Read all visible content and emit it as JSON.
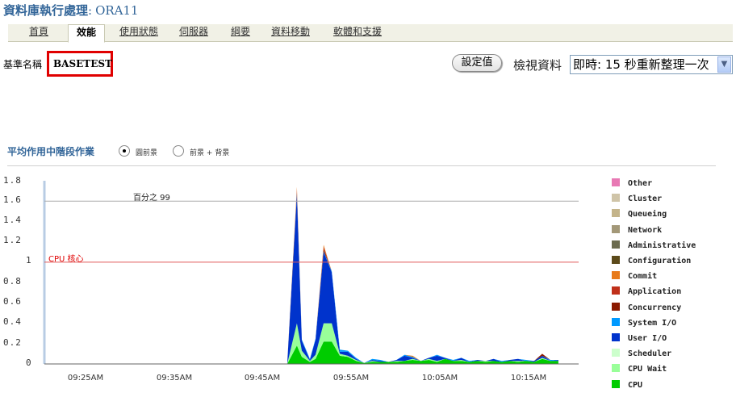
{
  "page": {
    "title_bold": "資料庫執行處理",
    "title_db": "ORA11"
  },
  "tabs": [
    {
      "label": "首頁",
      "active": false
    },
    {
      "label": "效能",
      "active": true
    },
    {
      "label": "使用狀態",
      "active": false
    },
    {
      "label": "伺服器",
      "active": false
    },
    {
      "label": "綱要",
      "active": false
    },
    {
      "label": "資料移動",
      "active": false
    },
    {
      "label": "軟體和支援",
      "active": false
    }
  ],
  "baseline": {
    "label": "基準名稱",
    "value": "BASETEST"
  },
  "toolbar": {
    "set_button": "設定值",
    "view_label": "檢視資料",
    "view_select_value": "即時: 15 秒重新整理一次"
  },
  "section": {
    "title": "平均作用中階段作業",
    "radio_1": "圓前景",
    "radio_2": "前景 + 背景",
    "radio_selected": 1
  },
  "chart_data": {
    "type": "area",
    "y_ticks": [
      "1.8",
      "1.6",
      "1.4",
      "1.2",
      "1",
      "0.8",
      "0.6",
      "0.4",
      "0.2",
      "0"
    ],
    "x_ticks": [
      "09:25AM",
      "09:35AM",
      "09:45AM",
      "09:55AM",
      "10:05AM",
      "10:15AM"
    ],
    "ylim": [
      0,
      1.8
    ],
    "percentile_line": {
      "label": "百分之 99",
      "value": 1.6,
      "color": "#aaaaaa"
    },
    "cpu_cores_line": {
      "label": "CPU 核心",
      "value": 1.0,
      "color": "#e05a5a"
    },
    "x_minutes": [
      0,
      27,
      28.2,
      28.8,
      29.8,
      30.5,
      31.5,
      32.5,
      33.5,
      34.5,
      35.5,
      36.5,
      37.5,
      38.5,
      39.5,
      40.5,
      41.5,
      42.5,
      43.5,
      44.5,
      45.5,
      46.5,
      47.5,
      48.5,
      49.5,
      50.5,
      51.5,
      52.5,
      53.5,
      54.5,
      55.5,
      56.5,
      57.5,
      58.5,
      59.5,
      60.5
    ],
    "series": [
      {
        "name": "CPU",
        "color": "#00cc00",
        "values": [
          0,
          0,
          0.18,
          0.07,
          0.02,
          0.05,
          0.22,
          0.22,
          0.08,
          0.07,
          0.03,
          0.01,
          0.02,
          0.02,
          0.02,
          0.02,
          0.03,
          0.04,
          0.03,
          0.04,
          0.02,
          0.05,
          0.03,
          0.03,
          0.02,
          0.03,
          0.02,
          0.03,
          0.02,
          0.03,
          0.02,
          0.03,
          0.02,
          0.05,
          0.03,
          0.03
        ]
      },
      {
        "name": "CPU Wait",
        "color": "#99ff99",
        "values": [
          0,
          0,
          0.22,
          0.06,
          0.01,
          0.04,
          0.18,
          0.18,
          0.02,
          0.01,
          0.01,
          0,
          0.01,
          0,
          0,
          0.01,
          0,
          0.01,
          0,
          0.01,
          0.01,
          0,
          0,
          0.01,
          0,
          0,
          0.01,
          0,
          0,
          0,
          0.01,
          0,
          0,
          0.01,
          0,
          0
        ]
      },
      {
        "name": "User I/O",
        "color": "#0033cc",
        "values": [
          0,
          0,
          1.26,
          0.1,
          0.01,
          0.15,
          0.7,
          0.5,
          0.02,
          0.04,
          0.01,
          0,
          0.01,
          0.01,
          0,
          0.01,
          0.05,
          0.01,
          0,
          0.01,
          0.05,
          0.01,
          0,
          0.02,
          0,
          0.01,
          0,
          0.02,
          0,
          0.01,
          0.02,
          0,
          0.01,
          0.02,
          0,
          0.01
        ]
      },
      {
        "name": "System I/O",
        "color": "#0099ff",
        "values": [
          0,
          0,
          0.02,
          0.01,
          0.01,
          0.01,
          0.01,
          0.01,
          0.02,
          0.01,
          0.01,
          0,
          0.01,
          0.01,
          0,
          0,
          0.01,
          0.01,
          0,
          0,
          0.01,
          0,
          0.01,
          0,
          0.01,
          0,
          0,
          0,
          0.01,
          0,
          0,
          0.01,
          0,
          0,
          0.01,
          0
        ]
      },
      {
        "name": "Concurrency",
        "color": "#8b1a00",
        "values": [
          0,
          0,
          0.02,
          0,
          0,
          0,
          0.02,
          0,
          0,
          0,
          0,
          0,
          0,
          0,
          0,
          0,
          0,
          0,
          0,
          0,
          0,
          0,
          0,
          0,
          0,
          0,
          0,
          0,
          0,
          0,
          0,
          0,
          0,
          0.02,
          0,
          0
        ]
      },
      {
        "name": "Application",
        "color": "#c0301a",
        "values": [
          0,
          0,
          0.02,
          0,
          0,
          0,
          0.02,
          0,
          0,
          0,
          0,
          0,
          0,
          0,
          0,
          0,
          0,
          0,
          0,
          0,
          0,
          0,
          0,
          0,
          0,
          0,
          0,
          0,
          0,
          0,
          0,
          0,
          0,
          0,
          0,
          0
        ]
      },
      {
        "name": "Commit",
        "color": "#e87a1a",
        "values": [
          0,
          0,
          0.02,
          0,
          0,
          0,
          0.02,
          0,
          0,
          0,
          0,
          0,
          0,
          0,
          0,
          0,
          0,
          0.01,
          0,
          0,
          0,
          0,
          0,
          0,
          0,
          0,
          0,
          0,
          0,
          0,
          0,
          0,
          0,
          0,
          0,
          0
        ]
      },
      {
        "name": "Configuration",
        "color": "#5c4a1a",
        "values": [
          0,
          0,
          0,
          0,
          0,
          0,
          0,
          0,
          0,
          0,
          0,
          0,
          0,
          0,
          0,
          0,
          0,
          0,
          0,
          0,
          0,
          0,
          0,
          0,
          0,
          0,
          0,
          0,
          0,
          0,
          0,
          0,
          0,
          0,
          0,
          0
        ]
      },
      {
        "name": "Administrative",
        "color": "#6b6b4e",
        "values": [
          0,
          0,
          0,
          0,
          0,
          0,
          0,
          0,
          0,
          0,
          0,
          0,
          0,
          0,
          0,
          0,
          0,
          0,
          0,
          0,
          0,
          0,
          0,
          0,
          0,
          0,
          0,
          0,
          0,
          0,
          0,
          0,
          0,
          0,
          0,
          0
        ]
      },
      {
        "name": "Network",
        "color": "#a39878",
        "values": [
          0,
          0,
          0,
          0,
          0,
          0,
          0,
          0,
          0,
          0,
          0,
          0,
          0,
          0,
          0,
          0,
          0,
          0,
          0,
          0,
          0,
          0,
          0,
          0,
          0,
          0,
          0,
          0,
          0,
          0,
          0,
          0,
          0,
          0,
          0,
          0
        ]
      },
      {
        "name": "Queueing",
        "color": "#c4b48a",
        "values": [
          0,
          0,
          0,
          0,
          0,
          0,
          0,
          0,
          0,
          0,
          0,
          0,
          0,
          0,
          0,
          0,
          0,
          0,
          0,
          0,
          0,
          0,
          0,
          0,
          0,
          0,
          0,
          0,
          0,
          0,
          0,
          0,
          0,
          0,
          0,
          0
        ]
      },
      {
        "name": "Cluster",
        "color": "#cfc4a8",
        "values": [
          0,
          0,
          0,
          0,
          0,
          0,
          0,
          0,
          0,
          0,
          0,
          0,
          0,
          0,
          0,
          0,
          0,
          0,
          0,
          0,
          0,
          0,
          0,
          0,
          0,
          0,
          0,
          0,
          0,
          0,
          0,
          0,
          0,
          0,
          0,
          0
        ]
      },
      {
        "name": "Other",
        "color": "#e879b4",
        "values": [
          0,
          0,
          0,
          0,
          0,
          0,
          0,
          0,
          0,
          0,
          0,
          0,
          0,
          0,
          0,
          0,
          0,
          0,
          0,
          0,
          0,
          0,
          0,
          0,
          0,
          0,
          0,
          0,
          0,
          0,
          0,
          0,
          0,
          0,
          0,
          0
        ]
      }
    ],
    "legend": [
      {
        "name": "Other",
        "color": "#e879b4"
      },
      {
        "name": "Cluster",
        "color": "#cfc4a8"
      },
      {
        "name": "Queueing",
        "color": "#c4b48a"
      },
      {
        "name": "Network",
        "color": "#a39878"
      },
      {
        "name": "Administrative",
        "color": "#6b6b4e"
      },
      {
        "name": "Configuration",
        "color": "#5c4a1a"
      },
      {
        "name": "Commit",
        "color": "#e87a1a"
      },
      {
        "name": "Application",
        "color": "#c0301a"
      },
      {
        "name": "Concurrency",
        "color": "#8b1a00"
      },
      {
        "name": "System I/O",
        "color": "#0099ff"
      },
      {
        "name": "User I/O",
        "color": "#0033cc"
      },
      {
        "name": "Scheduler",
        "color": "#ccffcc"
      },
      {
        "name": "CPU Wait",
        "color": "#99ff99"
      },
      {
        "name": "CPU",
        "color": "#00cc00"
      }
    ]
  }
}
